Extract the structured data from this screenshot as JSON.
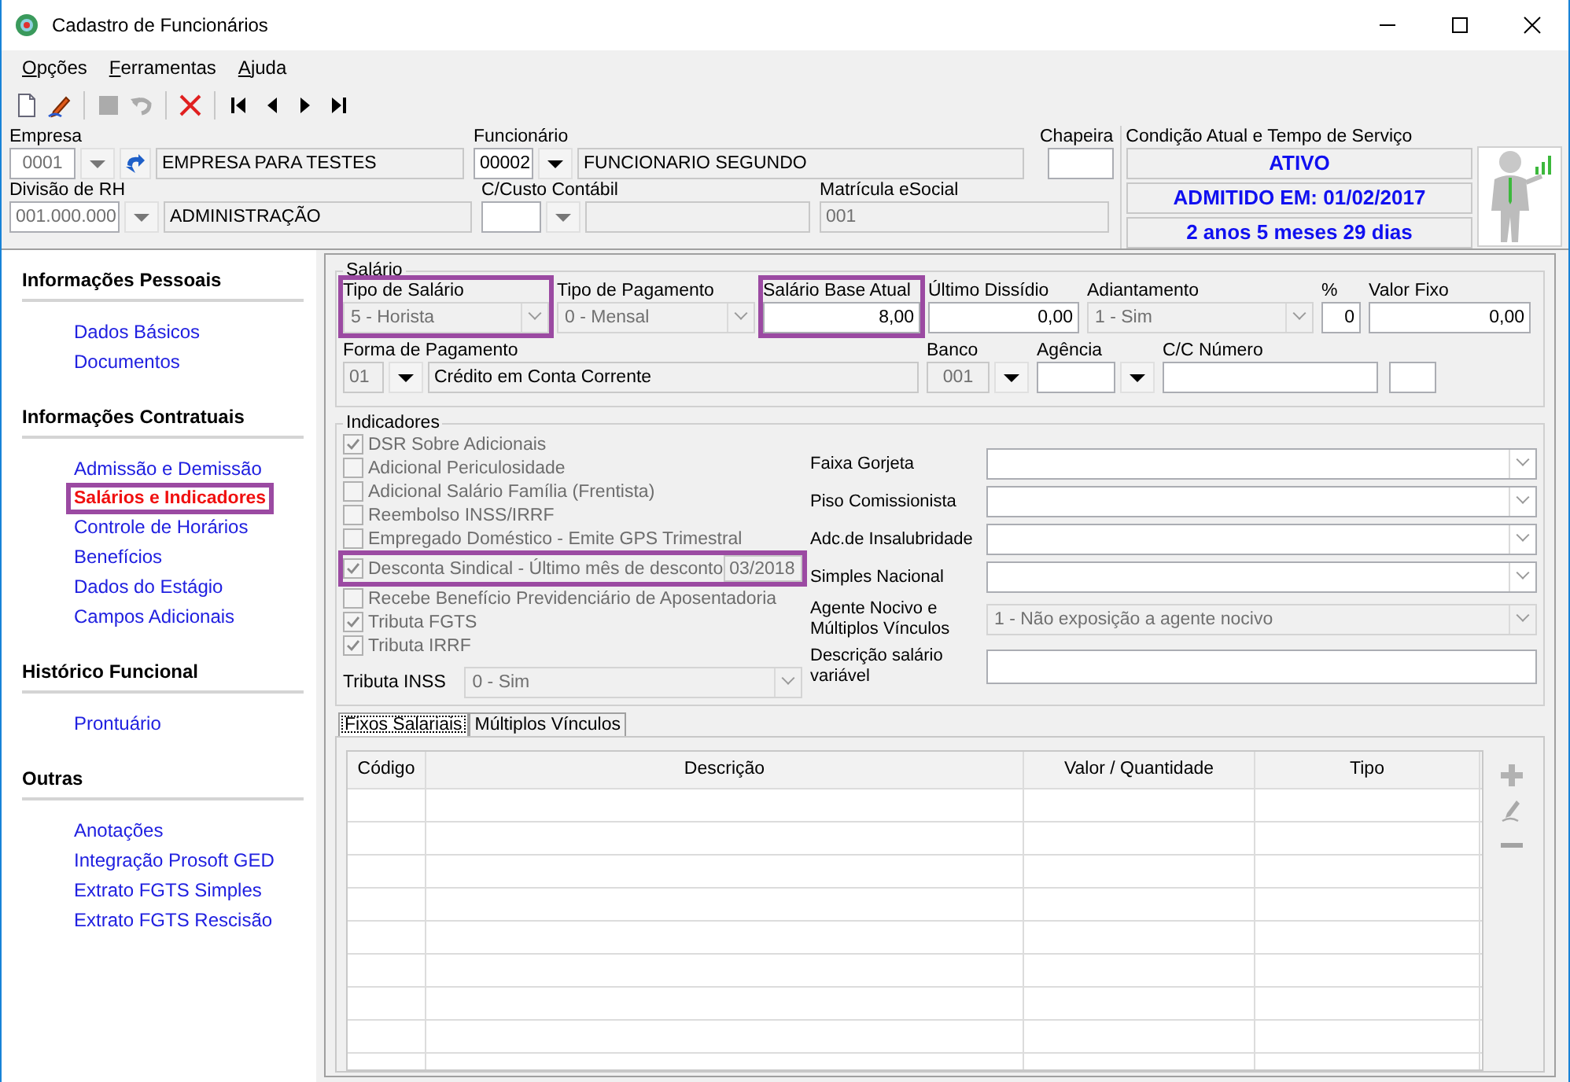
{
  "window": {
    "title": "Cadastro de Funcionários"
  },
  "menu": [
    "Opções",
    "Ferramentas",
    "Ajuda"
  ],
  "toolbar": [
    {
      "kind": "new",
      "disabled": false
    },
    {
      "kind": "edit",
      "disabled": false
    },
    {
      "kind": "separator"
    },
    {
      "kind": "save",
      "disabled": true
    },
    {
      "kind": "undo",
      "disabled": true
    },
    {
      "kind": "separator"
    },
    {
      "kind": "delete",
      "disabled": false
    },
    {
      "kind": "separator"
    },
    {
      "kind": "first",
      "disabled": false
    },
    {
      "kind": "prev",
      "disabled": false
    },
    {
      "kind": "next",
      "disabled": false
    },
    {
      "kind": "last",
      "disabled": false
    }
  ],
  "header": {
    "empresa": {
      "label": "Empresa",
      "code": "0001",
      "name": "EMPRESA PARA TESTES"
    },
    "funcionario": {
      "label": "Funcionário",
      "code": "00002",
      "name": "FUNCIONARIO SEGUNDO"
    },
    "chapeira": {
      "label": "Chapeira"
    },
    "divisao": {
      "label": "Divisão de RH",
      "code": "001.000.000",
      "name": "ADMINISTRAÇÃO"
    },
    "ccusto": {
      "label": "C/Custo Contábil"
    },
    "matricula": {
      "label": "Matrícula eSocial",
      "value": "001"
    },
    "status": {
      "label": "Condição Atual e Tempo de Serviço",
      "lines": [
        "ATIVO",
        "ADMITIDO EM: 01/02/2017",
        "2 anos 5 meses 29 dias"
      ]
    }
  },
  "sidebar": {
    "groups": [
      {
        "title": "Informações Pessoais",
        "items": [
          {
            "label": "Dados Básicos",
            "selected": false
          },
          {
            "label": "Documentos",
            "selected": false
          }
        ]
      },
      {
        "title": "Informações Contratuais",
        "items": [
          {
            "label": "Admissão e Demissão",
            "selected": false
          },
          {
            "label": "Salários e Indicadores",
            "selected": true
          },
          {
            "label": "Controle de Horários",
            "selected": false
          },
          {
            "label": "Benefícios",
            "selected": false
          },
          {
            "label": "Dados do Estágio",
            "selected": false
          },
          {
            "label": "Campos Adicionais",
            "selected": false
          }
        ]
      },
      {
        "title": "Histórico Funcional",
        "items": [
          {
            "label": "Prontuário",
            "selected": false
          }
        ]
      },
      {
        "title": "Outras",
        "items": [
          {
            "label": "Anotações",
            "selected": false
          },
          {
            "label": "Integração Prosoft GED",
            "selected": false
          },
          {
            "label": "Extrato FGTS Simples",
            "selected": false
          },
          {
            "label": "Extrato FGTS Rescisão",
            "selected": false
          }
        ]
      }
    ]
  },
  "salario": {
    "title": "Salário",
    "fields": [
      {
        "kind": "select",
        "label": "Tipo de Salário",
        "value": "5 - Horista",
        "disabled": true,
        "highlighted": true
      },
      {
        "kind": "select",
        "label": "Tipo de Pagamento",
        "value": "0 - Mensal",
        "disabled": true,
        "highlighted": false
      },
      {
        "kind": "number",
        "label": "Salário Base Atual",
        "value": "8,00",
        "highlighted": true
      },
      {
        "kind": "number",
        "label": "Último Dissídio",
        "value": "0,00",
        "highlighted": false
      },
      {
        "kind": "select",
        "label": "Adiantamento",
        "value": "1 - Sim",
        "disabled": true,
        "highlighted": false
      },
      {
        "kind": "number",
        "label": "%",
        "value": "0",
        "highlighted": false
      },
      {
        "kind": "number",
        "label": "Valor Fixo",
        "value": "0,00",
        "highlighted": false
      }
    ],
    "payment": {
      "forma": {
        "label": "Forma de Pagamento",
        "code": "01",
        "name": "Crédito em Conta Corrente"
      },
      "banco": {
        "label": "Banco",
        "code": "001"
      },
      "agencia": {
        "label": "Agência"
      },
      "conta": {
        "label": "C/C Número"
      }
    }
  },
  "indicadores": {
    "title": "Indicadores",
    "checks": [
      {
        "kind": "checkbox",
        "label": "DSR Sobre Adicionais",
        "checked": true
      },
      {
        "kind": "checkbox",
        "label": "Adicional Periculosidade",
        "checked": false
      },
      {
        "kind": "checkbox",
        "label": "Adicional Salário Família (Frentista)",
        "checked": false
      },
      {
        "kind": "checkbox",
        "label": "Reembolso INSS/IRRF",
        "checked": false
      },
      {
        "kind": "checkbox",
        "label": "Empregado Doméstico - Emite GPS Trimestral",
        "checked": false
      },
      {
        "kind": "checkbox_field",
        "label": "Desconta Sindical - Último mês de desconto",
        "checked": true,
        "value": "03/2018",
        "disabled": true,
        "highlighted": true
      },
      {
        "kind": "checkbox",
        "label": "Recebe Benefício Previdenciário de Aposentadoria",
        "checked": false
      },
      {
        "kind": "checkbox",
        "label": "Tributa FGTS",
        "checked": true
      },
      {
        "kind": "checkbox",
        "label": "Tributa IRRF",
        "checked": true
      },
      {
        "kind": "select",
        "label": "Tributa INSS",
        "value": "0 - Sim",
        "disabled": true
      }
    ],
    "fields": [
      {
        "kind": "select",
        "label": "Faixa Gorjeta"
      },
      {
        "kind": "select",
        "label": "Piso Comissionista"
      },
      {
        "kind": "select",
        "label": "Adc.de Insalubridade"
      },
      {
        "kind": "select",
        "label": "Simples Nacional"
      },
      {
        "kind": "select",
        "label": "Agente Nocivo e Múltiplos Vínculos",
        "value": "1 - Não exposição a agente nocivo",
        "disabled": true
      },
      {
        "kind": "input",
        "label": "Descrição salário variável"
      }
    ]
  },
  "tabs": [
    {
      "label": "Fixos Salariais",
      "selected": true
    },
    {
      "label": "Múltiplos Vínculos",
      "selected": false
    }
  ],
  "table": {
    "columns": [
      "Código",
      "Descrição",
      "Valor / Quantidade",
      "Tipo"
    ]
  },
  "table_actions": [
    {
      "kind": "add",
      "disabled": true
    },
    {
      "kind": "edit",
      "disabled": true
    },
    {
      "kind": "remove",
      "disabled": true
    }
  ]
}
